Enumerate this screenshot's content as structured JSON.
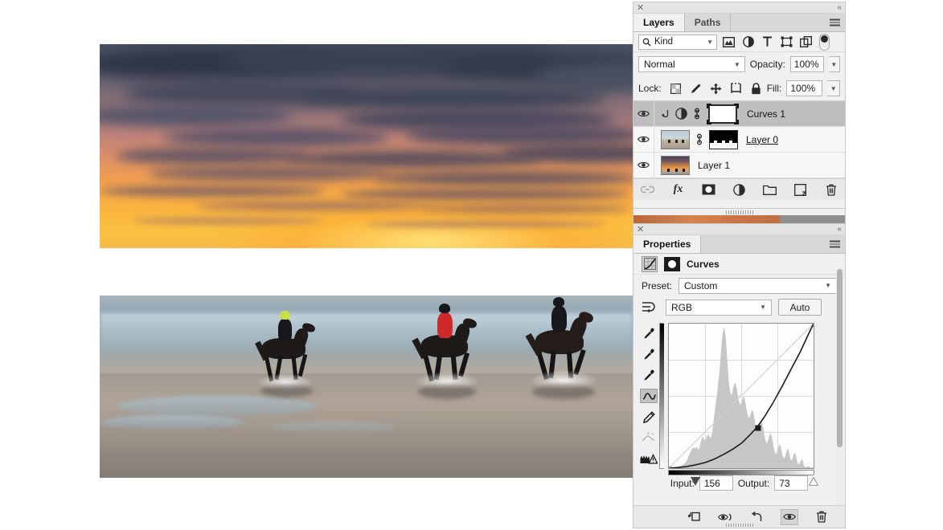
{
  "canvas": {
    "description": "Three horseback riders galloping through shallow water on a beach at sunset with dramatic orange sky and dark clouds"
  },
  "layers_panel": {
    "tabs": [
      {
        "label": "Layers",
        "active": true
      },
      {
        "label": "Paths",
        "active": false
      }
    ],
    "filter": {
      "kind_label": "Kind",
      "search_icon": "search-icon",
      "filter_icons": [
        "image-filter-icon",
        "adjustment-filter-icon",
        "type-filter-icon",
        "shape-filter-icon",
        "smart-object-filter-icon"
      ],
      "toggle": "filter-enable-toggle"
    },
    "blend_mode": "Normal",
    "opacity_label": "Opacity:",
    "opacity_value": "100%",
    "lock_label": "Lock:",
    "lock_icons": [
      "lock-transparency-icon",
      "lock-image-icon",
      "lock-position-icon",
      "lock-artboard-icon",
      "lock-all-icon"
    ],
    "fill_label": "Fill:",
    "fill_value": "100%",
    "layers": [
      {
        "name": "Curves 1",
        "selected": true,
        "visible": true,
        "underline": false,
        "kind": "adjustment"
      },
      {
        "name": "Layer 0",
        "selected": false,
        "visible": true,
        "underline": true,
        "kind": "pixel-mask"
      },
      {
        "name": "Layer 1",
        "selected": false,
        "visible": true,
        "underline": false,
        "kind": "pixel"
      }
    ],
    "bottom_icons": [
      "link-layers-icon",
      "layer-style-fx-icon",
      "add-mask-icon",
      "new-adjustment-icon",
      "new-group-icon",
      "new-layer-icon",
      "delete-layer-icon"
    ]
  },
  "properties_panel": {
    "tab_label": "Properties",
    "title": "Curves",
    "preset_label": "Preset:",
    "preset_value": "Custom",
    "channel_value": "RGB",
    "auto_label": "Auto",
    "tools": [
      "black-point-eyedropper-icon",
      "gray-point-eyedropper-icon",
      "white-point-eyedropper-icon",
      "curve-edit-icon",
      "pencil-draw-icon",
      "smooth-curve-icon",
      "clipping-warning-icon"
    ],
    "active_tool": "curve-edit-icon",
    "input_label": "Input:",
    "input_value": "156",
    "output_label": "Output:",
    "output_value": "73",
    "bottom_icons": [
      "clip-to-layer-icon",
      "preview-previous-icon",
      "reset-icon",
      "toggle-visibility-icon",
      "delete-adjustment-icon"
    ]
  },
  "chart_data": {
    "type": "line",
    "title": "Curves — RGB",
    "xlabel": "Input",
    "ylabel": "Output",
    "xlim": [
      0,
      255
    ],
    "ylim": [
      0,
      255
    ],
    "grid": true,
    "control_points": [
      {
        "input": 0,
        "output": 0,
        "filled": false
      },
      {
        "input": 156,
        "output": 73,
        "filled": true
      },
      {
        "input": 255,
        "output": 255,
        "filled": false
      }
    ],
    "curve_points": [
      [
        0,
        0
      ],
      [
        16,
        1
      ],
      [
        32,
        3
      ],
      [
        48,
        6
      ],
      [
        64,
        10
      ],
      [
        80,
        16
      ],
      [
        96,
        24
      ],
      [
        112,
        33
      ],
      [
        128,
        44
      ],
      [
        144,
        60
      ],
      [
        156,
        73
      ],
      [
        168,
        90
      ],
      [
        184,
        116
      ],
      [
        200,
        145
      ],
      [
        216,
        176
      ],
      [
        232,
        206
      ],
      [
        244,
        232
      ],
      [
        255,
        255
      ]
    ],
    "histogram": [
      2,
      2,
      2,
      2,
      2,
      2,
      3,
      3,
      3,
      3,
      3,
      4,
      4,
      4,
      4,
      5,
      5,
      5,
      6,
      6,
      7,
      7,
      8,
      8,
      9,
      10,
      11,
      12,
      13,
      14,
      16,
      18,
      20,
      23,
      26,
      30,
      34,
      38,
      42,
      46,
      50,
      54,
      58,
      60,
      62,
      63,
      64,
      64,
      63,
      62,
      62,
      64,
      66,
      64,
      60,
      58,
      60,
      64,
      70,
      78,
      86,
      92,
      96,
      98,
      96,
      92,
      88,
      86,
      88,
      92,
      96,
      100,
      104,
      106,
      104,
      100,
      96,
      94,
      96,
      100,
      108,
      118,
      130,
      144,
      158,
      172,
      186,
      198,
      210,
      222,
      236,
      252,
      268,
      284,
      300,
      320,
      342,
      364,
      386,
      404,
      418,
      428,
      434,
      436,
      430,
      418,
      400,
      378,
      352,
      326,
      300,
      278,
      260,
      246,
      236,
      230,
      228,
      230,
      236,
      244,
      252,
      258,
      262,
      264,
      262,
      256,
      248,
      238,
      228,
      218,
      210,
      204,
      200,
      198,
      200,
      204,
      210,
      216,
      220,
      222,
      220,
      214,
      206,
      196,
      186,
      176,
      168,
      162,
      158,
      156,
      158,
      162,
      168,
      174,
      178,
      180,
      178,
      172,
      164,
      154,
      144,
      134,
      126,
      120,
      116,
      114,
      116,
      120,
      126,
      132,
      138,
      142,
      144,
      142,
      136,
      128,
      118,
      108,
      98,
      90,
      84,
      80,
      78,
      80,
      84,
      90,
      96,
      102,
      106,
      108,
      106,
      100,
      92,
      82,
      72,
      64,
      56,
      50,
      46,
      44,
      46,
      50,
      56,
      62,
      68,
      72,
      74,
      72,
      66,
      58,
      50,
      42,
      36,
      32,
      30,
      32,
      36,
      42,
      48,
      54,
      58,
      60,
      58,
      52,
      44,
      36,
      30,
      26,
      24,
      26,
      30,
      36,
      42,
      46,
      48,
      46,
      40,
      32,
      24,
      18,
      14,
      12,
      12,
      14,
      18,
      22,
      26,
      28,
      26,
      22,
      16,
      10,
      6,
      4,
      3,
      3,
      4,
      5,
      6,
      6,
      5,
      4,
      3,
      2,
      2,
      2,
      2,
      2,
      2,
      2
    ],
    "diagonal_reference": true,
    "shadow_slider": 0,
    "highlight_slider": 255
  }
}
